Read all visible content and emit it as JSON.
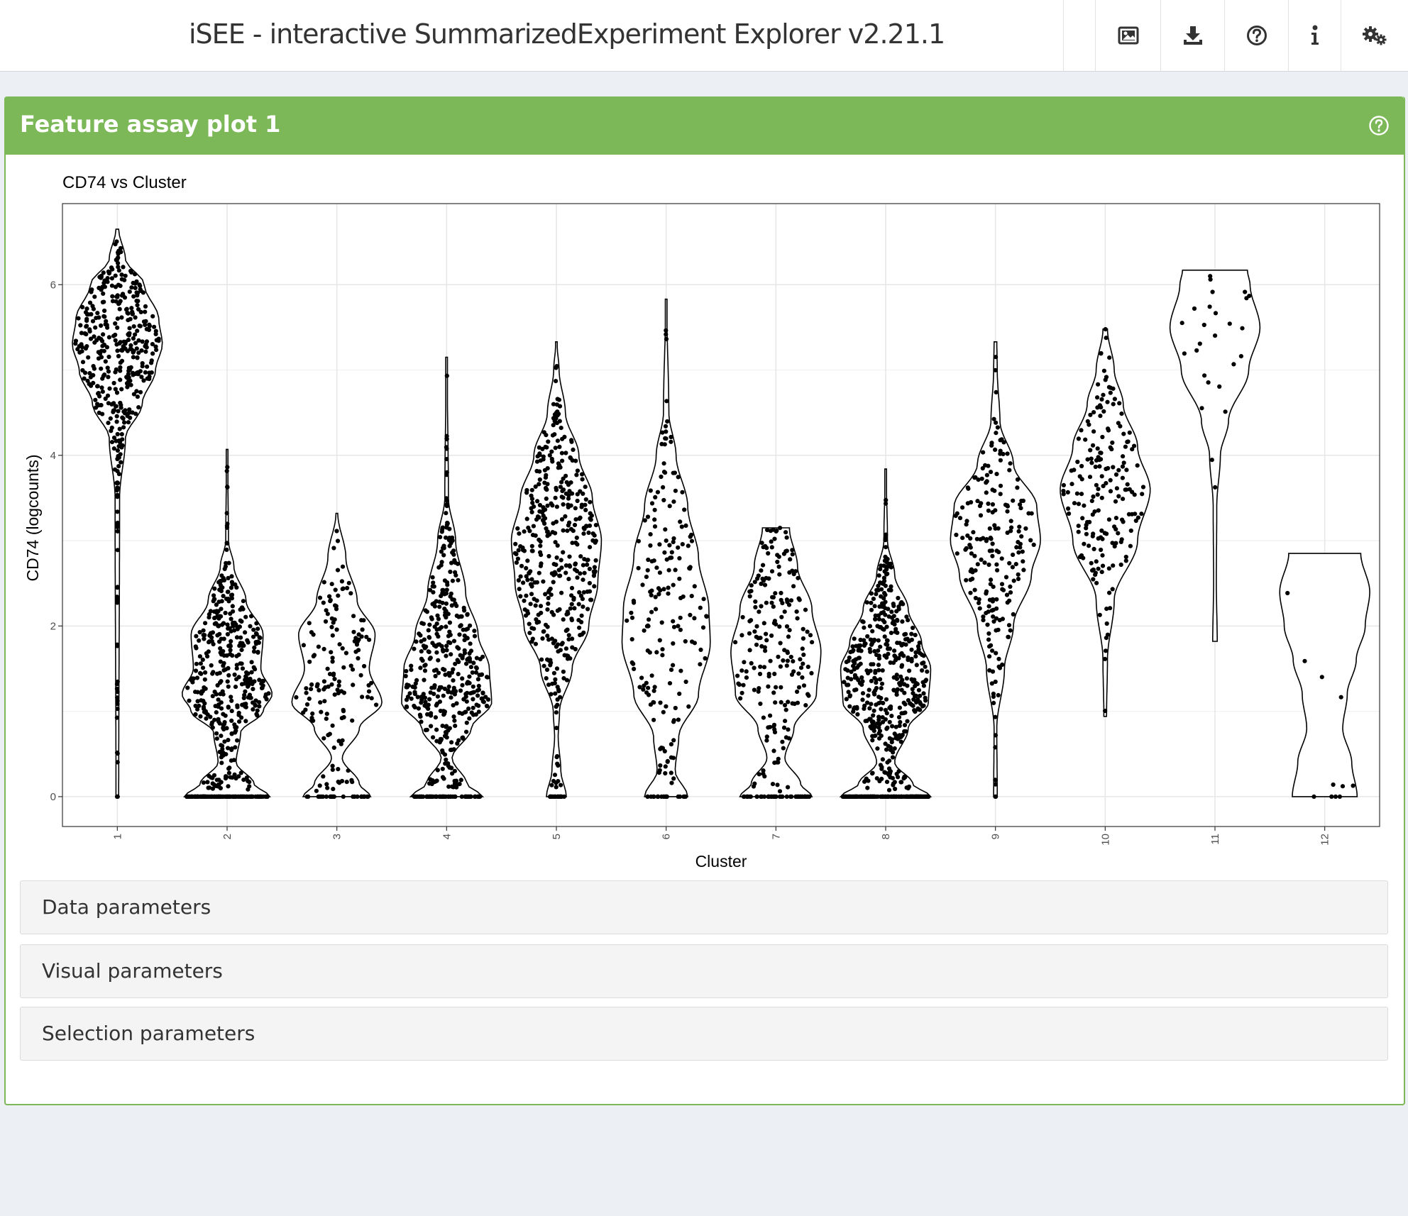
{
  "header": {
    "title": "iSEE - interactive SummarizedExperiment Explorer v2.21.1",
    "buttons": [
      {
        "icon": "image-icon"
      },
      {
        "icon": "download-icon"
      },
      {
        "icon": "question-circle-icon"
      },
      {
        "icon": "info-icon"
      },
      {
        "icon": "gears-icon"
      }
    ]
  },
  "panel": {
    "title": "Feature assay plot 1",
    "accent_color": "#7cb857"
  },
  "sections": [
    {
      "label": "Data parameters"
    },
    {
      "label": "Visual parameters"
    },
    {
      "label": "Selection parameters"
    }
  ],
  "chart_data": {
    "type": "violin",
    "title": "CD74 vs Cluster",
    "xlabel": "Cluster",
    "ylabel": "CD74 (logcounts)",
    "categories": [
      "1",
      "2",
      "3",
      "4",
      "5",
      "6",
      "7",
      "8",
      "9",
      "10",
      "11",
      "12"
    ],
    "y_ticks": [
      0,
      2,
      4,
      6
    ],
    "ylim": [
      -0.35,
      6.95
    ],
    "grid": true,
    "groups": [
      {
        "category": "1",
        "min": 0,
        "max": 6.65,
        "n": 420,
        "zero_frac": 0.005,
        "profile": [
          [
            0,
            0.03
          ],
          [
            3.5,
            0.05
          ],
          [
            4.2,
            0.18
          ],
          [
            4.6,
            0.55
          ],
          [
            5.0,
            0.85
          ],
          [
            5.3,
            1.0
          ],
          [
            5.6,
            0.92
          ],
          [
            6.0,
            0.6
          ],
          [
            6.3,
            0.18
          ],
          [
            6.65,
            0.03
          ]
        ]
      },
      {
        "category": "2",
        "min": 0,
        "max": 4.07,
        "n": 520,
        "zero_frac": 0.22,
        "profile": [
          [
            0,
            0.95
          ],
          [
            0.15,
            0.6
          ],
          [
            0.4,
            0.2
          ],
          [
            0.75,
            0.3
          ],
          [
            1.0,
            0.8
          ],
          [
            1.2,
            1.0
          ],
          [
            1.5,
            0.75
          ],
          [
            1.9,
            0.8
          ],
          [
            2.3,
            0.42
          ],
          [
            2.7,
            0.15
          ],
          [
            3.0,
            0.03
          ],
          [
            4.07,
            0.01
          ]
        ]
      },
      {
        "category": "3",
        "min": 0,
        "max": 3.32,
        "n": 170,
        "zero_frac": 0.15,
        "profile": [
          [
            0,
            0.75
          ],
          [
            0.15,
            0.5
          ],
          [
            0.45,
            0.12
          ],
          [
            0.8,
            0.5
          ],
          [
            1.1,
            1.0
          ],
          [
            1.5,
            0.72
          ],
          [
            1.9,
            0.85
          ],
          [
            2.3,
            0.45
          ],
          [
            2.8,
            0.2
          ],
          [
            3.32,
            0.02
          ]
        ]
      },
      {
        "category": "4",
        "min": 0,
        "max": 5.15,
        "n": 470,
        "zero_frac": 0.14,
        "profile": [
          [
            0,
            0.8
          ],
          [
            0.15,
            0.45
          ],
          [
            0.45,
            0.12
          ],
          [
            0.8,
            0.55
          ],
          [
            1.1,
            1.0
          ],
          [
            1.5,
            0.95
          ],
          [
            1.9,
            0.7
          ],
          [
            2.4,
            0.42
          ],
          [
            3.0,
            0.2
          ],
          [
            3.5,
            0.04
          ],
          [
            5.15,
            0.01
          ]
        ]
      },
      {
        "category": "5",
        "min": 0,
        "max": 5.33,
        "n": 440,
        "zero_frac": 0.05,
        "profile": [
          [
            0,
            0.22
          ],
          [
            0.3,
            0.1
          ],
          [
            0.7,
            0.04
          ],
          [
            1.0,
            0.07
          ],
          [
            1.5,
            0.35
          ],
          [
            2.0,
            0.72
          ],
          [
            2.5,
            0.92
          ],
          [
            3.0,
            1.0
          ],
          [
            3.5,
            0.8
          ],
          [
            4.0,
            0.5
          ],
          [
            4.5,
            0.2
          ],
          [
            5.0,
            0.06
          ],
          [
            5.33,
            0.01
          ]
        ]
      },
      {
        "category": "6",
        "min": 0,
        "max": 5.83,
        "n": 200,
        "zero_frac": 0.1,
        "profile": [
          [
            0,
            0.48
          ],
          [
            0.3,
            0.2
          ],
          [
            0.7,
            0.28
          ],
          [
            1.2,
            0.72
          ],
          [
            1.8,
            0.98
          ],
          [
            2.2,
            0.95
          ],
          [
            2.8,
            0.72
          ],
          [
            3.4,
            0.48
          ],
          [
            4.0,
            0.22
          ],
          [
            4.5,
            0.06
          ],
          [
            5.83,
            0.01
          ]
        ]
      },
      {
        "category": "7",
        "min": 0,
        "max": 3.15,
        "n": 250,
        "zero_frac": 0.2,
        "profile": [
          [
            0,
            0.8
          ],
          [
            0.15,
            0.55
          ],
          [
            0.45,
            0.2
          ],
          [
            0.8,
            0.4
          ],
          [
            1.2,
            0.9
          ],
          [
            1.7,
            1.0
          ],
          [
            2.2,
            0.8
          ],
          [
            2.7,
            0.48
          ],
          [
            3.15,
            0.3
          ]
        ]
      },
      {
        "category": "8",
        "min": 0,
        "max": 3.84,
        "n": 600,
        "zero_frac": 0.26,
        "profile": [
          [
            0,
            1.0
          ],
          [
            0.15,
            0.6
          ],
          [
            0.4,
            0.2
          ],
          [
            0.8,
            0.5
          ],
          [
            1.1,
            0.95
          ],
          [
            1.5,
            1.0
          ],
          [
            1.8,
            0.8
          ],
          [
            2.2,
            0.5
          ],
          [
            2.6,
            0.2
          ],
          [
            3.0,
            0.04
          ],
          [
            3.84,
            0.01
          ]
        ]
      },
      {
        "category": "9",
        "min": 0,
        "max": 5.33,
        "n": 210,
        "zero_frac": 0.01,
        "profile": [
          [
            0,
            0.04
          ],
          [
            0.8,
            0.03
          ],
          [
            1.5,
            0.2
          ],
          [
            2.0,
            0.4
          ],
          [
            2.6,
            0.8
          ],
          [
            3.0,
            1.0
          ],
          [
            3.4,
            0.92
          ],
          [
            3.9,
            0.4
          ],
          [
            4.4,
            0.1
          ],
          [
            5.0,
            0.04
          ],
          [
            5.33,
            0.03
          ]
        ]
      },
      {
        "category": "10",
        "min": 0.94,
        "max": 5.48,
        "n": 190,
        "zero_frac": 0,
        "profile": [
          [
            0.94,
            0.03
          ],
          [
            1.6,
            0.05
          ],
          [
            2.3,
            0.2
          ],
          [
            3.0,
            0.72
          ],
          [
            3.6,
            1.0
          ],
          [
            4.1,
            0.72
          ],
          [
            4.6,
            0.4
          ],
          [
            5.0,
            0.2
          ],
          [
            5.48,
            0.05
          ]
        ]
      },
      {
        "category": "11",
        "min": 1.82,
        "max": 6.17,
        "n": 26,
        "zero_frac": 0,
        "profile": [
          [
            1.82,
            0.05
          ],
          [
            2.5,
            0.03
          ],
          [
            3.4,
            0.04
          ],
          [
            4.0,
            0.12
          ],
          [
            4.4,
            0.3
          ],
          [
            5.0,
            0.75
          ],
          [
            5.5,
            1.0
          ],
          [
            6.0,
            0.78
          ],
          [
            6.17,
            0.72
          ]
        ]
      },
      {
        "category": "12",
        "min": 0,
        "max": 2.85,
        "n": 11,
        "zero_frac": 0.36,
        "profile": [
          [
            0,
            0.72
          ],
          [
            0.4,
            0.6
          ],
          [
            0.8,
            0.4
          ],
          [
            1.2,
            0.5
          ],
          [
            1.6,
            0.7
          ],
          [
            2.0,
            0.9
          ],
          [
            2.4,
            1.0
          ],
          [
            2.85,
            0.8
          ]
        ]
      }
    ]
  }
}
